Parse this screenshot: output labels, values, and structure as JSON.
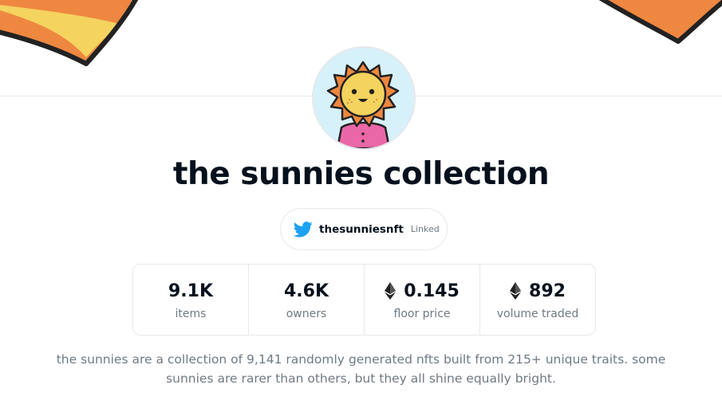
{
  "collection": {
    "title": "the sunnies collection",
    "description": "the sunnies are a collection of 9,141 randomly generated nfts built from 215+ unique traits. some sunnies are rarer than others, but they all shine equally bright."
  },
  "social": {
    "handle": "thesunniesnft",
    "status": "Linked",
    "icon": "twitter-icon"
  },
  "stats": [
    {
      "value": "9.1K",
      "label": "items",
      "icon": null
    },
    {
      "value": "4.6K",
      "label": "owners",
      "icon": null
    },
    {
      "value": "0.145",
      "label": "floor price",
      "icon": "eth-icon"
    },
    {
      "value": "892",
      "label": "volume traded",
      "icon": "eth-icon"
    }
  ],
  "colors": {
    "banner_orange": "#ee8740",
    "banner_yellow": "#f4d35e",
    "avatar_bg": "#d7f1fb",
    "twitter_blue": "#1da1f2",
    "text_primary": "#04111d",
    "text_secondary": "#707a83",
    "border": "#e5e8eb"
  }
}
